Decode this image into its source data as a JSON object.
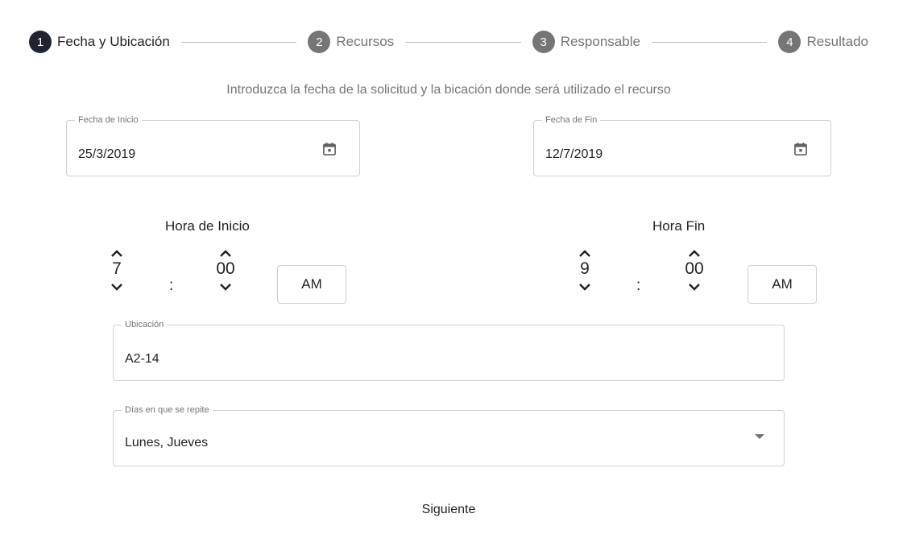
{
  "stepper": {
    "steps": [
      {
        "number": "1",
        "label": "Fecha y Ubicación"
      },
      {
        "number": "2",
        "label": "Recursos"
      },
      {
        "number": "3",
        "label": "Responsable"
      },
      {
        "number": "4",
        "label": "Resultado"
      }
    ],
    "active_step": 1
  },
  "instructions": "Introduzca la fecha de la solicitud y la bicación donde será utilizado el recurso",
  "start_date": {
    "label": "Fecha de Inicio",
    "value": "25/3/2019",
    "icon": "calendar-icon"
  },
  "end_date": {
    "label": "Fecha de Fin",
    "value": "12/7/2019",
    "icon": "calendar-icon"
  },
  "start_time": {
    "title": "Hora de Inicio",
    "hour": "7",
    "separator": ":",
    "minute": "00",
    "period": "AM"
  },
  "end_time": {
    "title": "Hora Fin",
    "hour": "9",
    "separator": ":",
    "minute": "00",
    "period": "AM"
  },
  "location": {
    "label": "Ubicación",
    "value": "A2-14"
  },
  "repeat_days": {
    "label": "Días en que se repite",
    "value": "Lunes, Jueves",
    "icon": "dropdown-arrow-icon"
  },
  "next_button": {
    "label": "Siguiente"
  },
  "colors": {
    "active_step": "#1f2430",
    "inactive_step": "#757575",
    "border": "#d0d0d0"
  }
}
